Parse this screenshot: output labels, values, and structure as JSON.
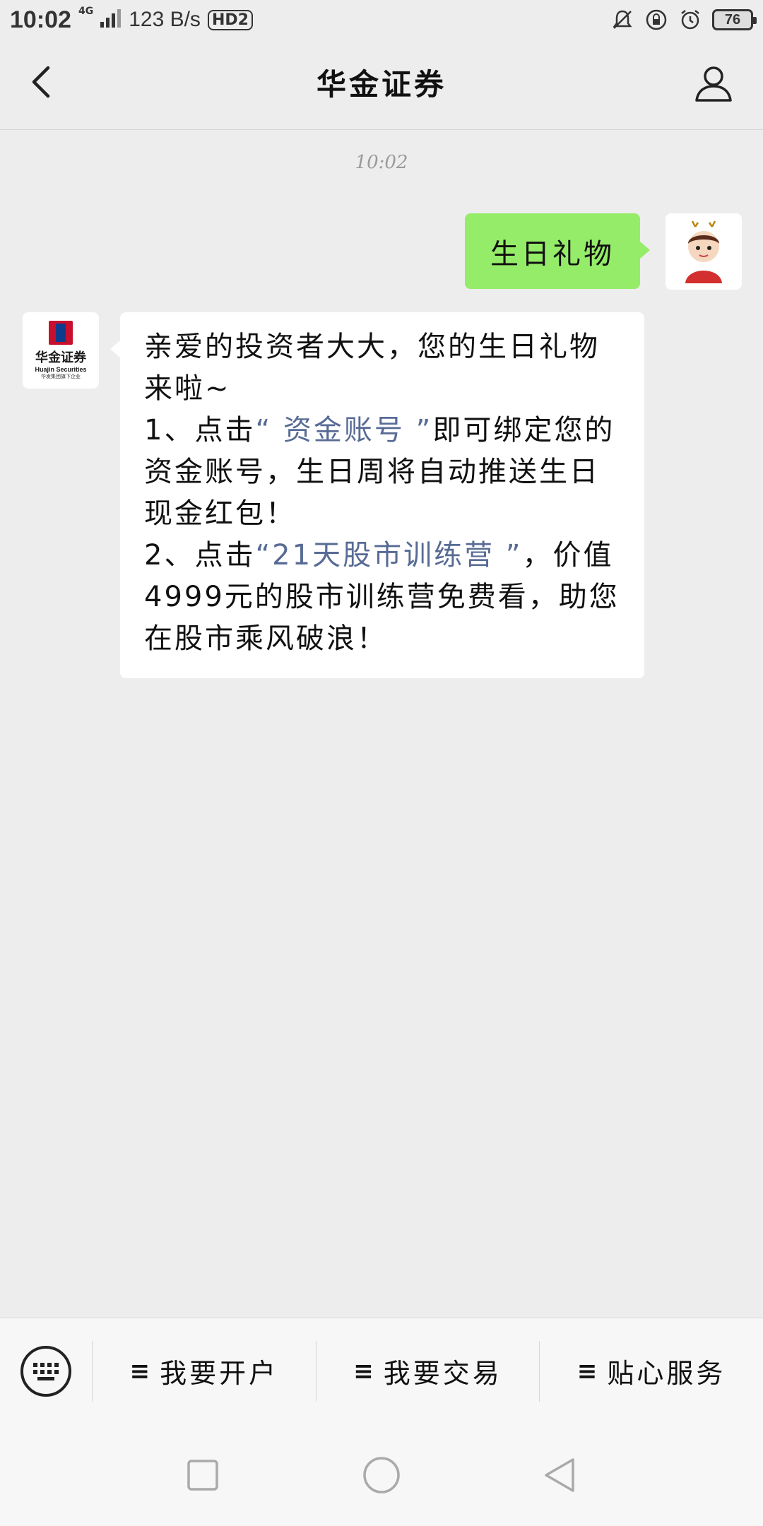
{
  "status_bar": {
    "time": "10:02",
    "network": "4G",
    "speed": "123 B/s",
    "hd": "HD2",
    "battery": "76",
    "icons": [
      "bell-muted-icon",
      "lock-rotation-icon",
      "alarm-icon",
      "battery-icon"
    ]
  },
  "header": {
    "title": "华金证券",
    "back_icon": "chevron-left-icon",
    "profile_icon": "person-icon"
  },
  "chat": {
    "timestamp": "10:02",
    "messages": [
      {
        "from": "user",
        "text": "生日礼物"
      },
      {
        "from": "bot",
        "intro": "亲爱的投资者大大，您的生日礼物来啦~",
        "line1_prefix": "1、点击",
        "line1_link": "“ 资金账号 ”",
        "line1_suffix": "即可绑定您的资金账号，生日周将自动推送生日现金红包！",
        "line2_prefix": "2、点击",
        "line2_link": "“21天股市训练营 ”",
        "line2_suffix": "，价值4999元的股市训练营免费看，助您在股市乘风破浪！"
      }
    ],
    "bot_logo": {
      "cn": "华金证券",
      "en": "Huajin Securities",
      "sub": "华发集团旗下企业"
    }
  },
  "menu": {
    "keyboard_icon": "keyboard-icon",
    "items": [
      {
        "label": "我要开户"
      },
      {
        "label": "我要交易"
      },
      {
        "label": "贴心服务"
      }
    ],
    "hamburger": "≡"
  },
  "navbar": {
    "icons": [
      "recent-apps-icon",
      "home-icon",
      "back-triangle-icon"
    ]
  },
  "colors": {
    "background": "#ededed",
    "user_bubble": "#95ec69",
    "link": "#576b95"
  }
}
